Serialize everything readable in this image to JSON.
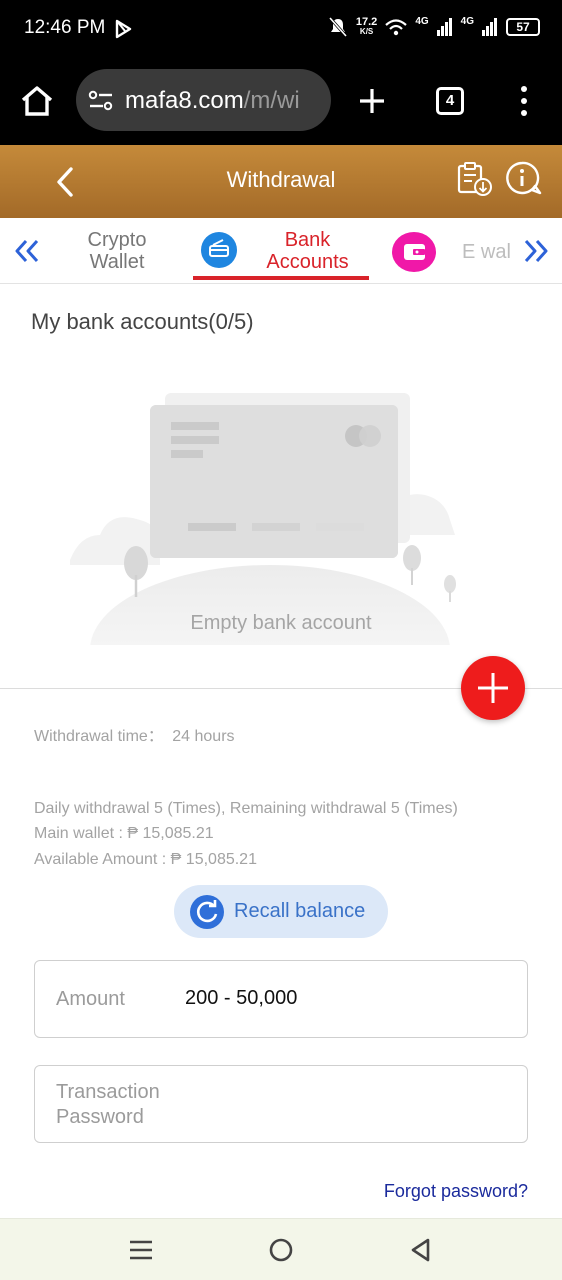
{
  "status_bar": {
    "time": "12:46 PM",
    "net_speed_top": "17.2",
    "net_speed_bottom": "K/S",
    "network_1": "4G",
    "network_2": "4G",
    "battery": "57"
  },
  "browser": {
    "url_main": "mafa8.com",
    "url_rest": "/m/wi",
    "tab_count": "4"
  },
  "header": {
    "title": "Withdrawal"
  },
  "tabs": [
    {
      "line1": "Crypto",
      "line2": "Wallet"
    },
    {
      "line1": "Bank",
      "line2": "Accounts"
    },
    {
      "line1": "E wal",
      "line2": ""
    }
  ],
  "bank": {
    "title": "My bank accounts(0/5)",
    "empty": "Empty bank account"
  },
  "info": {
    "withdrawal_time_label": "Withdrawal time：",
    "withdrawal_time_value": "24 hours",
    "daily": "Daily withdrawal 5 (Times), Remaining withdrawal 5 (Times)",
    "main_wallet": "Main wallet : ₱ 15,085.21",
    "available": "Available Amount : ₱ 15,085.21"
  },
  "recall_label": "Recall balance",
  "form": {
    "amount_label": "Amount",
    "amount_placeholder": "200 - 50,000",
    "password_label": "Transaction Password",
    "forgot": "Forgot password?"
  },
  "colors": {
    "header_gold": "#b07a30",
    "active_tab_red": "#d9232a",
    "add_button_red": "#ee1c1c",
    "recall_blue": "#2f6fd9",
    "link_navy": "#1a2a9c"
  }
}
